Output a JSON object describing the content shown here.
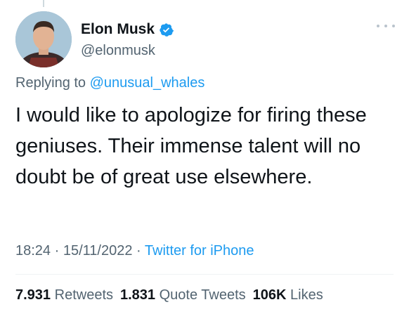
{
  "author": {
    "name": "Elon Musk",
    "handle": "@elonmusk",
    "verified_color": "#1d9bf0"
  },
  "reply": {
    "prefix": "Replying to ",
    "to_handle": "@unusual_whales"
  },
  "tweet": {
    "text": "I would like to apologize for firing these geniuses. Their immense talent will no doubt be of great use elsewhere."
  },
  "meta": {
    "time": "18:24",
    "sep1": " · ",
    "date": "15/11/2022",
    "sep2": " · ",
    "source": "Twitter for iPhone"
  },
  "stats": {
    "retweets_count": "7.931",
    "retweets_label": "Retweets",
    "quotes_count": "1.831",
    "quotes_label": "Quote Tweets",
    "likes_count": "106K",
    "likes_label": "Likes"
  },
  "icons": {
    "verified": "verified-badge-icon",
    "more": "more-options-icon"
  }
}
